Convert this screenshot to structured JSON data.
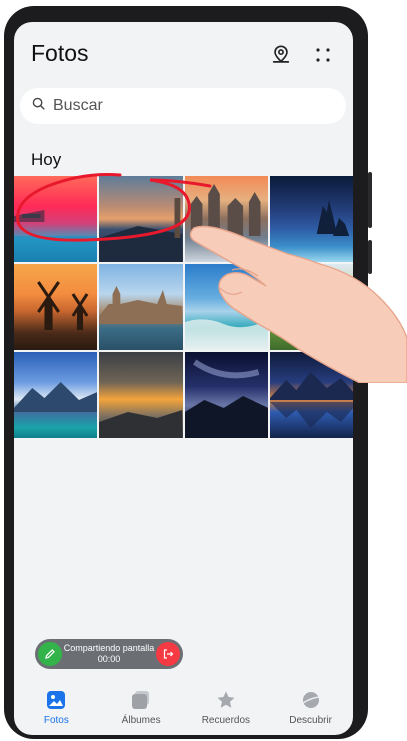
{
  "header": {
    "title": "Fotos"
  },
  "search": {
    "placeholder": "Buscar"
  },
  "section": {
    "title": "Hoy"
  },
  "photos": [
    {
      "name": "sunset-sea"
    },
    {
      "name": "dusk-coast"
    },
    {
      "name": "old-town"
    },
    {
      "name": "night-rocks"
    },
    {
      "name": "windmills"
    },
    {
      "name": "city-lake"
    },
    {
      "name": "beach-waves"
    },
    {
      "name": "green-field"
    },
    {
      "name": "mountain-lake"
    },
    {
      "name": "sea-of-clouds"
    },
    {
      "name": "milky-way"
    },
    {
      "name": "lake-reflection"
    }
  ],
  "screen_share": {
    "title": "Compartiendo pantalla",
    "time": "00:00"
  },
  "tabs": [
    {
      "label": "Fotos",
      "active": true
    },
    {
      "label": "Álbumes",
      "active": false
    },
    {
      "label": "Recuerdos",
      "active": false
    },
    {
      "label": "Descubrir",
      "active": false
    }
  ],
  "colors": {
    "accent": "#1a73e8",
    "annotation": "#e8192c",
    "share_green": "#33b44a",
    "share_red": "#f53a44"
  }
}
